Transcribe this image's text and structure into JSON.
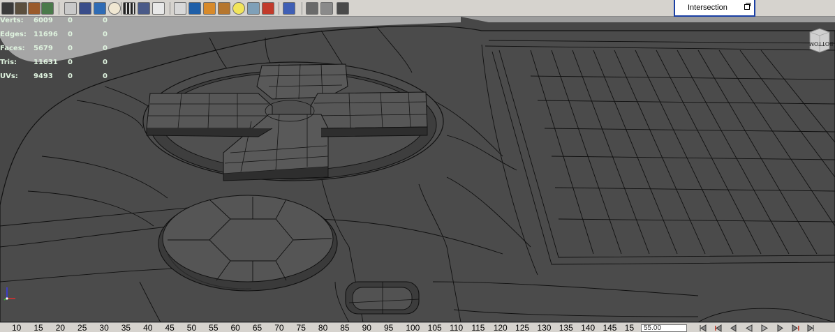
{
  "toolbar": {
    "icons": [
      "render-view-icon",
      "render-icon",
      "ipr-render-icon",
      "render-settings-icon",
      "wireframe-icon",
      "smooth-shade-icon",
      "shaded-icon",
      "default-material-icon",
      "xray-icon",
      "isolate-icon",
      "texture-icon",
      "camera-icon",
      "light-icon",
      "shadow-icon",
      "bounding-box-icon",
      "resolution-gate-icon",
      "safe-area-icon",
      "grid-icon",
      "field-chart-icon",
      "hud-icon",
      "image-plane-icon"
    ],
    "menu_popup": {
      "label": "Intersection"
    }
  },
  "hud": {
    "rows": [
      {
        "label": "Verts:",
        "a": "6009",
        "b": "0",
        "c": "0"
      },
      {
        "label": "Edges:",
        "a": "11696",
        "b": "0",
        "c": "0"
      },
      {
        "label": "Faces:",
        "a": "5679",
        "b": "0",
        "c": "0"
      },
      {
        "label": "Tris:",
        "a": "11631",
        "b": "0",
        "c": "0"
      },
      {
        "label": "UVs:",
        "a": "9493",
        "b": "0",
        "c": "0"
      }
    ],
    "text_color": "#dff3df"
  },
  "viewcube": {
    "label": "BOTTOM"
  },
  "timeline": {
    "ticks": [
      "10",
      "15",
      "20",
      "25",
      "30",
      "35",
      "40",
      "45",
      "50",
      "55",
      "60",
      "65",
      "70",
      "75",
      "80",
      "85",
      "90",
      "95",
      "100",
      "105",
      "110",
      "115",
      "120",
      "125",
      "130",
      "135",
      "140",
      "145",
      "15"
    ],
    "time_field": "55.00"
  },
  "colors": {
    "toolbar_bg": "#d6d3ce",
    "viewport_bg": "#444444",
    "popup_border": "#1a3fa4"
  }
}
